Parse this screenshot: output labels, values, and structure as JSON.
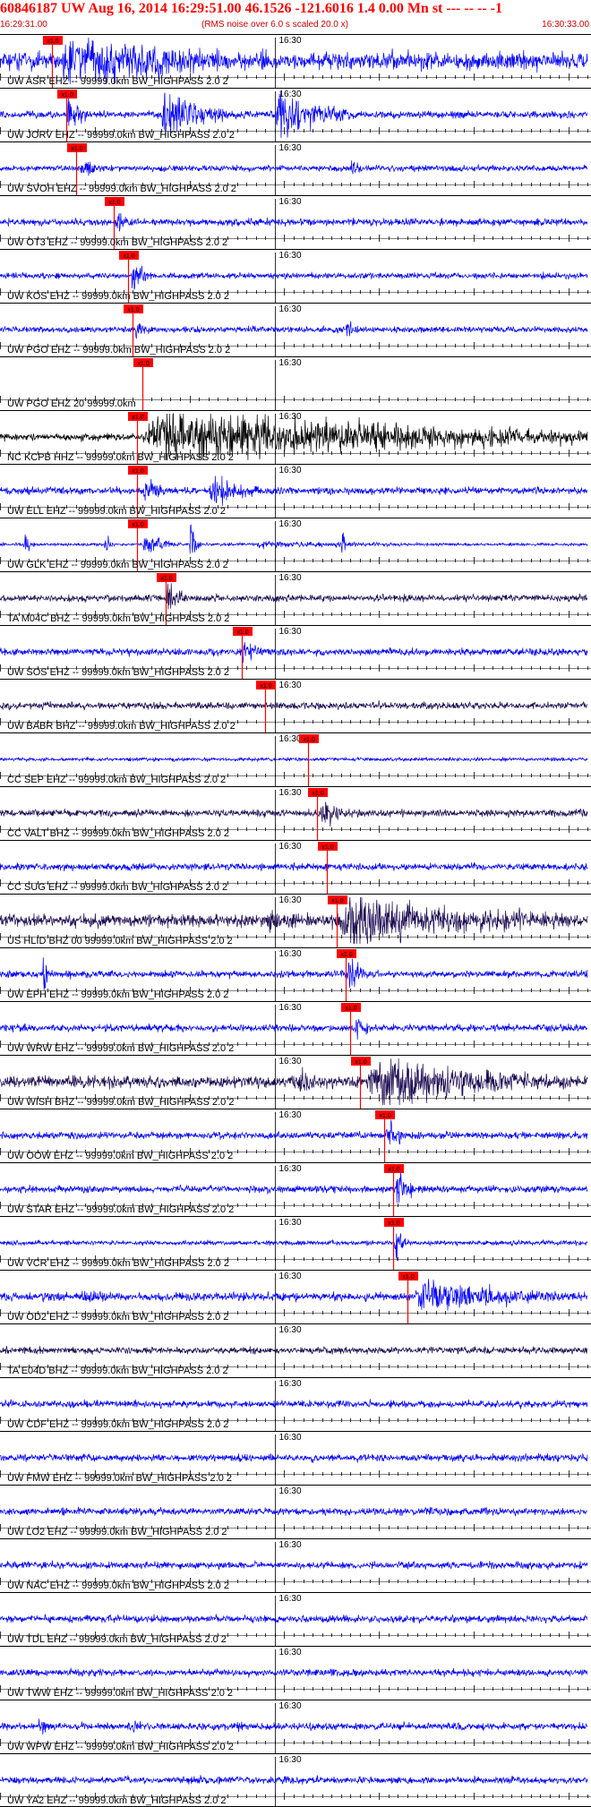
{
  "header": {
    "title": "60846187 UW Aug 16, 2014 16:29:51.00   46.1526 -121.6016  1.4 0.00 Mn st --- -- --  -1",
    "start_time": "16:29:31.00",
    "subtitle": "(RMS noise over 6.0 s scaled 20.0 x)",
    "end_time": "16:30:33.00"
  },
  "colors": {
    "background": "#ffffff",
    "trace_blue": "#0000ff",
    "trace_black": "#000000",
    "trace_navy": "#1a0a50",
    "pick_red": "#ff0000",
    "header_red": "#ff0000",
    "grid": "#000000"
  },
  "chart_data": {
    "type": "line",
    "title": "60846187 UW Aug 16, 2014 16:29:51.00   46.1526 -121.6016  1.4 0.00 Mn st --- -- --  -1",
    "subtitle": "(RMS noise over 6.0 s scaled 20.0 x)",
    "x_range": [
      "16:29:31.00",
      "16:30:33.00"
    ],
    "xlabel": "",
    "ylabel": "",
    "minute_label": "16:30",
    "minute_mark_seconds": 29,
    "window_seconds": 62,
    "pick_label": "x1.0",
    "grid": "vertical tick every second",
    "series": [
      {
        "label": "UW ASR EHZ -- 99999.0km BW_HIGHPASS  2.0  2",
        "pick_s": 5.5,
        "color": "blue",
        "amp": 0.55,
        "noise": 0.28,
        "events": [
          [
            6,
            28,
            1.0,
            0.9
          ]
        ]
      },
      {
        "label": "UW JORV EHZ -- 99999.0km BW_HIGHPASS  2.0  2",
        "pick_s": 7.0,
        "color": "blue",
        "amp": 0.55,
        "noise": 0.12,
        "events": [
          [
            7,
            3,
            0.55,
            1.2
          ],
          [
            17,
            7,
            0.95,
            1.0
          ],
          [
            29,
            8,
            0.85,
            1.0
          ]
        ]
      },
      {
        "label": "UW SVOH EHZ -- 99999.0km BW_HIGHPASS  2.0  2",
        "pick_s": 8.0,
        "color": "blue",
        "amp": 0.55,
        "noise": 0.1,
        "events": [
          [
            8.5,
            3,
            0.4,
            1.0
          ],
          [
            37,
            2,
            0.35,
            1.0
          ]
        ]
      },
      {
        "label": "UW OT3 EHZ -- 99999.0km BW_HIGHPASS  2.0  2",
        "pick_s": 12.0,
        "color": "blue",
        "amp": 0.55,
        "noise": 0.12,
        "events": [
          [
            12.2,
            2,
            0.4,
            1.2
          ]
        ]
      },
      {
        "label": "UW KOS EHZ -- 99999.0km BW_HIGHPASS  2.0  2",
        "pick_s": 13.5,
        "color": "blue",
        "amp": 0.55,
        "noise": 0.1,
        "events": [
          [
            13.8,
            2,
            0.65,
            1.5
          ]
        ]
      },
      {
        "label": "UW PGO EHZ -- 99999.0km BW_HIGHPASS  2.0  2",
        "pick_s": 14.0,
        "color": "blue",
        "amp": 0.55,
        "noise": 0.1,
        "events": [
          [
            14.3,
            2,
            0.45,
            1.2
          ],
          [
            36.5,
            2,
            0.35,
            1.0
          ]
        ]
      },
      {
        "label": "UW PGO EHZ 20 99999.0km",
        "pick_s": 15.0,
        "color": "blue",
        "amp": 0.55,
        "noise": 0.0,
        "events": []
      },
      {
        "label": "NC KCPB HHZ -- 99999.0km BW_HIGHPASS  2.0  2",
        "pick_s": 14.5,
        "color": "black",
        "amp": 0.6,
        "noise": 0.12,
        "events": [
          [
            14.5,
            48,
            1.0,
            0.95
          ]
        ]
      },
      {
        "label": "UW ELL EHZ -- 99999.0km BW_HIGHPASS  2.0  2",
        "pick_s": 14.5,
        "color": "blue",
        "amp": 0.55,
        "noise": 0.12,
        "events": [
          [
            15,
            4,
            0.45,
            1.2
          ],
          [
            22,
            6,
            0.6,
            1.0
          ]
        ]
      },
      {
        "label": "UW GLK EHZ -- 99999.0km BW_HIGHPASS  2.0  2",
        "pick_s": 14.5,
        "color": "blue",
        "amp": 0.55,
        "noise": 0.05,
        "events": [
          [
            2.5,
            1,
            0.5,
            2.0
          ],
          [
            11,
            1,
            0.4,
            2.0
          ],
          [
            15,
            3,
            0.45,
            1.2
          ],
          [
            20,
            1,
            0.8,
            2.0
          ],
          [
            26,
            30,
            0.15,
            0.8
          ],
          [
            36,
            0.5,
            0.8,
            2.0
          ]
        ]
      },
      {
        "label": "TA M04C BHZ -- 99999.0km BW_HIGHPASS  2.0  2",
        "pick_s": 17.5,
        "color": "navy",
        "amp": 0.55,
        "noise": 0.12,
        "events": [
          [
            17.5,
            2,
            0.85,
            1.8
          ]
        ]
      },
      {
        "label": "UW SOS EHZ -- 99999.0km BW_HIGHPASS  2.0  2",
        "pick_s": 25.5,
        "color": "blue",
        "amp": 0.55,
        "noise": 0.12,
        "events": [
          [
            25.5,
            2.5,
            0.45,
            1.2
          ]
        ]
      },
      {
        "label": "UW BABR BHZ -- 99999.0km BW_HIGHPASS  2.0  2",
        "pick_s": 28.0,
        "color": "navy",
        "amp": 0.45,
        "noise": 0.12,
        "events": []
      },
      {
        "label": "CC SEP EHZ -- 99999.0km BW_HIGHPASS  2.0  2",
        "pick_s": 32.5,
        "color": "blue",
        "amp": 0.55,
        "noise": 0.06,
        "events": [
          [
            2,
            8,
            0.06,
            1.0
          ],
          [
            31,
            6,
            0.08,
            1.0
          ]
        ]
      },
      {
        "label": "CC VALT BHZ -- 99999.0km BW_HIGHPASS  2.0  2",
        "pick_s": 33.5,
        "color": "navy",
        "amp": 0.55,
        "noise": 0.12,
        "events": [
          [
            33.8,
            3,
            0.6,
            1.3
          ]
        ]
      },
      {
        "label": "CC SUG EHZ -- 99999.0km BW_HIGHPASS  2.0  2",
        "pick_s": 34.5,
        "color": "blue",
        "amp": 0.55,
        "noise": 0.12,
        "events": [
          [
            34.5,
            2,
            0.2,
            1.0
          ]
        ]
      },
      {
        "label": "US HLID BHZ 00 99999.0km BW_HIGHPASS  2.0  2",
        "pick_s": 35.5,
        "color": "navy",
        "amp": 0.6,
        "noise": 0.22,
        "events": [
          [
            28,
            12,
            0.5,
            0.7
          ],
          [
            35.5,
            26,
            1.0,
            0.9
          ]
        ]
      },
      {
        "label": "UW EPH EHZ -- 99999.0km BW_HIGHPASS  2.0  2",
        "pick_s": 36.5,
        "color": "blue",
        "amp": 0.55,
        "noise": 0.12,
        "events": [
          [
            4.5,
            0.6,
            0.9,
            2.5
          ],
          [
            36.7,
            2,
            0.6,
            1.5
          ]
        ]
      },
      {
        "label": "UW WRW EHZ -- 99999.0km BW_HIGHPASS  2.0  2",
        "pick_s": 37.0,
        "color": "blue",
        "amp": 0.55,
        "noise": 0.12,
        "events": [
          [
            37.5,
            2,
            0.55,
            1.3
          ]
        ]
      },
      {
        "label": "UW WISH BHZ -- 99999.0km BW_HIGHPASS  2.0  2",
        "pick_s": 38.0,
        "color": "navy",
        "amp": 0.6,
        "noise": 0.2,
        "events": [
          [
            31,
            8,
            0.4,
            0.8
          ],
          [
            38.5,
            22,
            1.0,
            0.95
          ]
        ]
      },
      {
        "label": "UW OOW EHZ -- 99999.0km BW_HIGHPASS  2.0  2",
        "pick_s": 40.5,
        "color": "blue",
        "amp": 0.55,
        "noise": 0.12,
        "events": [
          [
            40.7,
            2,
            0.7,
            1.5
          ]
        ]
      },
      {
        "label": "UW STAR EHZ -- 99999.0km BW_HIGHPASS  2.0  2",
        "pick_s": 41.5,
        "color": "blue",
        "amp": 0.55,
        "noise": 0.12,
        "events": [
          [
            41.8,
            2,
            0.8,
            1.5
          ]
        ]
      },
      {
        "label": "UW VCR EHZ -- 99999.0km BW_HIGHPASS  2.0  2",
        "pick_s": 41.5,
        "color": "blue",
        "amp": 0.55,
        "noise": 0.08,
        "events": [
          [
            41.6,
            1.5,
            0.55,
            1.5
          ]
        ]
      },
      {
        "label": "UW OD2 EHZ -- 99999.0km BW_HIGHPASS  2.0  2",
        "pick_s": 43.0,
        "color": "blue",
        "amp": 0.55,
        "noise": 0.14,
        "events": [
          [
            43.5,
            18,
            0.65,
            1.0
          ],
          [
            8,
            14,
            0.22,
            1.0
          ]
        ]
      },
      {
        "label": "TA E04D BHZ -- 99999.0km BW_HIGHPASS  2.0  2",
        "pick_s": null,
        "color": "navy",
        "amp": 0.45,
        "noise": 0.12,
        "events": []
      },
      {
        "label": "UW CDF EHZ -- 99999.0km BW_HIGHPASS  2.0  2",
        "pick_s": null,
        "color": "blue",
        "amp": 0.55,
        "noise": 0.12,
        "events": []
      },
      {
        "label": "UW FMW EHZ -- 99999.0km BW_HIGHPASS  2.0  2",
        "pick_s": null,
        "color": "blue",
        "amp": 0.55,
        "noise": 0.12,
        "events": []
      },
      {
        "label": "UW LO2 EHZ -- 99999.0km BW_HIGHPASS  2.0  2",
        "pick_s": null,
        "color": "blue",
        "amp": 0.55,
        "noise": 0.12,
        "events": []
      },
      {
        "label": "UW NAC EHZ -- 99999.0km BW_HIGHPASS  2.0  2",
        "pick_s": null,
        "color": "blue",
        "amp": 0.55,
        "noise": 0.12,
        "events": []
      },
      {
        "label": "UW TDL EHZ -- 99999.0km BW_HIGHPASS  2.0  2",
        "pick_s": null,
        "color": "blue",
        "amp": 0.55,
        "noise": 0.12,
        "events": []
      },
      {
        "label": "UW TWW EHZ -- 99999.0km BW_HIGHPASS  2.0  2",
        "pick_s": null,
        "color": "blue",
        "amp": 0.55,
        "noise": 0.12,
        "events": []
      },
      {
        "label": "UW WPW EHZ -- 99999.0km BW_HIGHPASS  2.0  2",
        "pick_s": null,
        "color": "blue",
        "amp": 0.55,
        "noise": 0.12,
        "events": [
          [
            4,
            2,
            0.35,
            1.0
          ],
          [
            14,
            2,
            0.3,
            1.0
          ],
          [
            25,
            1,
            0.3,
            1.0
          ]
        ]
      },
      {
        "label": "UW YA2 EHZ -- 99999.0km BW_HIGHPASS  2.0  2",
        "pick_s": null,
        "color": "blue",
        "amp": 0.55,
        "noise": 0.12,
        "events": []
      }
    ]
  }
}
